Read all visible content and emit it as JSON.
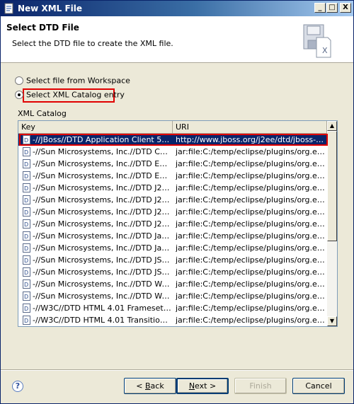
{
  "window": {
    "title": "New XML File"
  },
  "title_buttons": {
    "minimize": "_",
    "maximize": "□",
    "close": "X"
  },
  "header": {
    "title": "Select DTD File",
    "description": "Select the DTD file to create the XML file."
  },
  "options": {
    "workspace_label": "Select file from Workspace",
    "catalog_label": "Select XML Catalog entry",
    "selected": "catalog"
  },
  "catalog": {
    "label": "XML Catalog",
    "columns": [
      "Key",
      "URI"
    ],
    "rows": [
      {
        "key": "-//JBoss//DTD Application Client 5.0//EN",
        "uri": "http://www.jboss.org/j2ee/dtd/jboss-cli...",
        "selected": true
      },
      {
        "key": "-//Sun Microsystems, Inc.//DTD Conn...",
        "uri": "jar:file:C:/temp/eclipse/plugins/org.eclip..."
      },
      {
        "key": "-//Sun Microsystems, Inc.//DTD Enter...",
        "uri": "jar:file:C:/temp/eclipse/plugins/org.eclip..."
      },
      {
        "key": "-//Sun Microsystems, Inc.//DTD Enter...",
        "uri": "jar:file:C:/temp/eclipse/plugins/org.eclip..."
      },
      {
        "key": "-//Sun Microsystems, Inc.//DTD J2EE ...",
        "uri": "jar:file:C:/temp/eclipse/plugins/org.eclip..."
      },
      {
        "key": "-//Sun Microsystems, Inc.//DTD J2EE ...",
        "uri": "jar:file:C:/temp/eclipse/plugins/org.eclip..."
      },
      {
        "key": "-//Sun Microsystems, Inc.//DTD J2EE ...",
        "uri": "jar:file:C:/temp/eclipse/plugins/org.eclip..."
      },
      {
        "key": "-//Sun Microsystems, Inc.//DTD J2EE ...",
        "uri": "jar:file:C:/temp/eclipse/plugins/org.eclip..."
      },
      {
        "key": "-//Sun Microsystems, Inc.//DTD Java...",
        "uri": "jar:file:C:/temp/eclipse/plugins/org.eclip..."
      },
      {
        "key": "-//Sun Microsystems, Inc.//DTD Java...",
        "uri": "jar:file:C:/temp/eclipse/plugins/org.eclip..."
      },
      {
        "key": "-//Sun Microsystems, Inc.//DTD JSP T...",
        "uri": "jar:file:C:/temp/eclipse/plugins/org.eclip..."
      },
      {
        "key": "-//Sun Microsystems, Inc.//DTD JSP T...",
        "uri": "jar:file:C:/temp/eclipse/plugins/org.eclip..."
      },
      {
        "key": "-//Sun Microsystems, Inc.//DTD Web ...",
        "uri": "jar:file:C:/temp/eclipse/plugins/org.eclip..."
      },
      {
        "key": "-//Sun Microsystems, Inc.//DTD Web ...",
        "uri": "jar:file:C:/temp/eclipse/plugins/org.eclip..."
      },
      {
        "key": "-//W3C//DTD HTML 4.01 Frameset//EN",
        "uri": "jar:file:C:/temp/eclipse/plugins/org.eclip..."
      },
      {
        "key": "-//W3C//DTD HTML 4.01 Transitional/...",
        "uri": "jar:file:C:/temp/eclipse/plugins/org.eclip..."
      }
    ]
  },
  "footer": {
    "help": "?",
    "back_mnemonic": "B",
    "back_rest": "ack",
    "back_prefix": "< ",
    "next_mnemonic": "N",
    "next_rest": "ext >",
    "finish_label": "Finish",
    "cancel_label": "Cancel"
  },
  "colors": {
    "title_bar": "#0a246a",
    "selection": "#0a246a",
    "highlight": "#e00000"
  }
}
